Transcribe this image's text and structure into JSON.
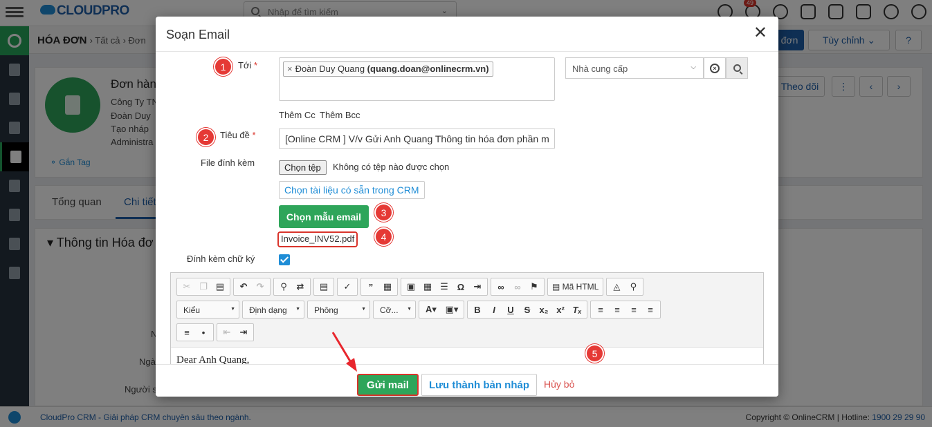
{
  "app": {
    "brand_logo": "CLOUDPRO",
    "search_placeholder": "Nhập để tìm kiếm",
    "notification_count": "49",
    "breadcrumb_module": "HÓA ĐƠN",
    "breadcrumb_all": "Tất cả",
    "breadcrumb_item": "Đơn",
    "btn_add": "đơn",
    "btn_customize": "Tùy chỉnh",
    "btn_follow": "Theo dõi",
    "record_title": "Đơn hàn",
    "record_lines": [
      "Công Ty TN",
      "Đoàn Duy",
      "Tạo nháp",
      "Administra"
    ],
    "tag_link": "Gắn Tag",
    "tabs": [
      "Tổng quan",
      "Chi tiết"
    ],
    "section_title": "Thông tin Hóa đơ",
    "bg_labels": [
      "N",
      "Ngà",
      "Người s"
    ]
  },
  "footer": {
    "left": "CloudPro CRM - Giải pháp CRM chuyên sâu theo ngành.",
    "right_text": "Copyright © OnlineCRM | Hotline:",
    "hotline": "1900 29 29 90"
  },
  "modal": {
    "title": "Soạn Email",
    "to_label": "Tới",
    "to_recipient_name": "Đoàn Duy Quang",
    "to_recipient_email": "(quang.doan@onlinecrm.vn)",
    "recipient_type": "Nhà cung cấp",
    "add_cc": "Thêm Cc",
    "add_bcc": "Thêm Bcc",
    "subject_label": "Tiêu đề",
    "subject_value": "[Online CRM ] V/v Gửi Anh Quang Thông tin hóa đơn phần m",
    "attachment_label": "File đính kèm",
    "choose_file": "Chọn tệp",
    "no_file": "Không có tệp nào được chọn",
    "choose_crm_doc": "Chọn tài liệu có sẵn trong CRM",
    "choose_template": "Chọn mẫu email",
    "attached_file": "Invoice_INV52.pdf",
    "signature_label": "Đính kèm chữ ký",
    "signature_checked": true,
    "editor": {
      "source_label": "Mã HTML",
      "style_combo": "Kiểu",
      "format_combo": "Định dạng",
      "font_combo": "Phông",
      "size_combo": "Cỡ...",
      "body_text": "Dear Anh Quang,"
    },
    "send": "Gửi mail",
    "save_draft": "Lưu thành bản nháp",
    "cancel": "Hủy bỏ",
    "step_markers": [
      "1",
      "2",
      "3",
      "4",
      "5"
    ]
  },
  "colors": {
    "primary_green": "#2ea55a",
    "link_blue": "#1f8dd6",
    "highlight_red": "#e53935"
  }
}
